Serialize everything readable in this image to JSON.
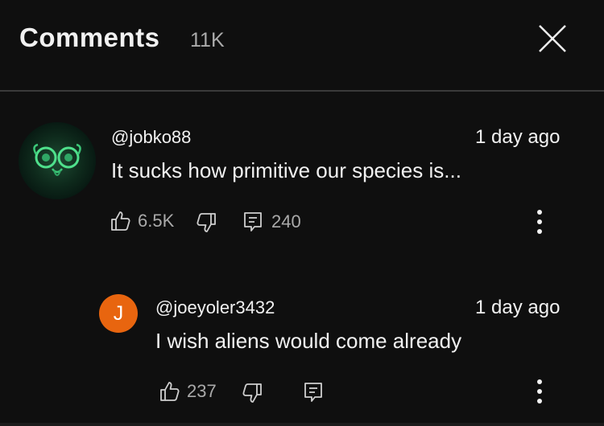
{
  "header": {
    "title": "Comments",
    "count": "11K"
  },
  "comment": {
    "username": "@jobko88",
    "timestamp": "1 day ago",
    "text": "It sucks how primitive our species is...",
    "likes": "6.5K",
    "replies": "240"
  },
  "reply": {
    "avatar_letter": "J",
    "avatar_color": "#e8650f",
    "username": "@joeyoler3432",
    "timestamp": "1 day ago",
    "text": "I wish aliens would come already",
    "likes": "237"
  },
  "icons": {
    "close": "close-icon",
    "like": "thumbs-up-icon",
    "dislike": "thumbs-down-icon",
    "reply": "comment-icon",
    "more": "more-vertical-icon"
  },
  "colors": {
    "background": "#0f0f0f",
    "text_primary": "#f1f1f1",
    "text_secondary": "#aaaaaa",
    "divider": "#3a3a3a"
  }
}
